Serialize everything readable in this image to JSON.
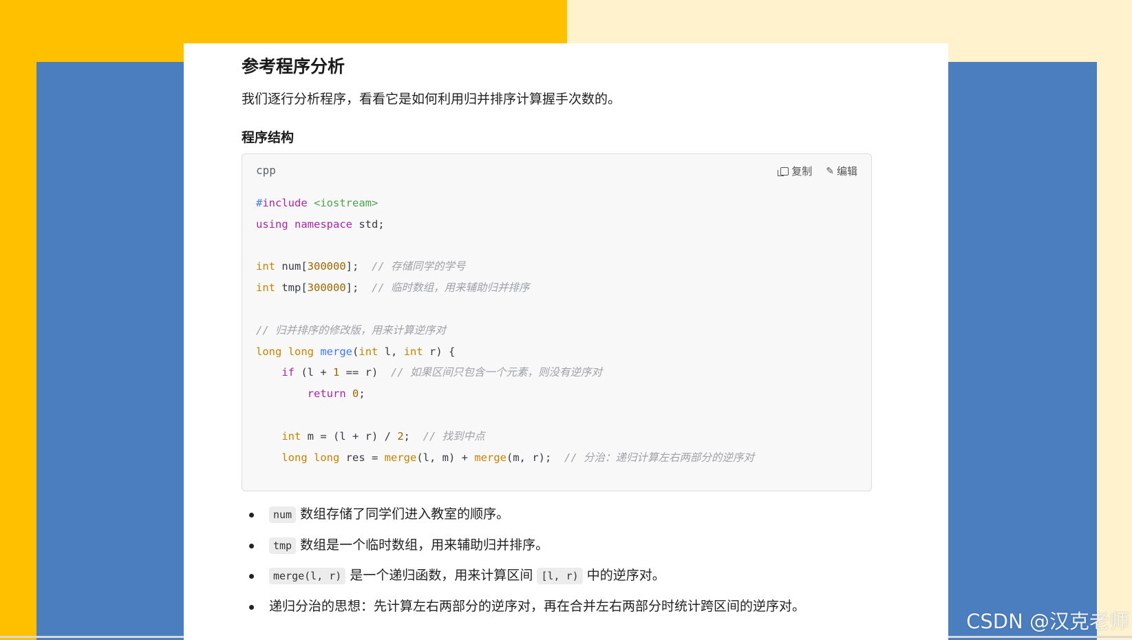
{
  "article": {
    "heading": "参考程序分析",
    "intro": "我们逐行分析程序，看看它是如何利用归并排序计算握手次数的。",
    "subheading": "程序结构"
  },
  "code_block": {
    "language": "cpp",
    "copy_label": "复制",
    "edit_label": "编辑",
    "lines": [
      "#include <iostream>",
      "using namespace std;",
      "",
      "int num[300000];  // 存储同学的学号",
      "int tmp[300000];  // 临时数组，用来辅助归并排序",
      "",
      "// 归并排序的修改版，用来计算逆序对",
      "long long merge(int l, int r) {",
      "    if (l + 1 == r)  // 如果区间只包含一个元素，则没有逆序对",
      "        return 0;",
      "",
      "    int m = (l + r) / 2;  // 找到中点",
      "    long long res = merge(l, m) + merge(m, r);  // 分治：递归计算左右两部分的逆序对"
    ]
  },
  "bullets": [
    {
      "code": "num",
      "text": "数组存储了同学们进入教室的顺序。"
    },
    {
      "code": "tmp",
      "text": "数组是一个临时数组，用来辅助归并排序。"
    },
    {
      "code": "merge(l, r)",
      "text": "是一个递归函数，用来计算区间",
      "code2": "[l, r)",
      "text2": "中的逆序对。"
    },
    {
      "text": "递归分治的思想：先计算左右两部分的逆序对，再在合并左右两部分时统计跨区间的逆序对。"
    }
  ],
  "watermark": "CSDN @汉克老师",
  "colors": {
    "yellow": "#ffc000",
    "cream": "#fff2cc",
    "blue": "#4a7ebf"
  }
}
